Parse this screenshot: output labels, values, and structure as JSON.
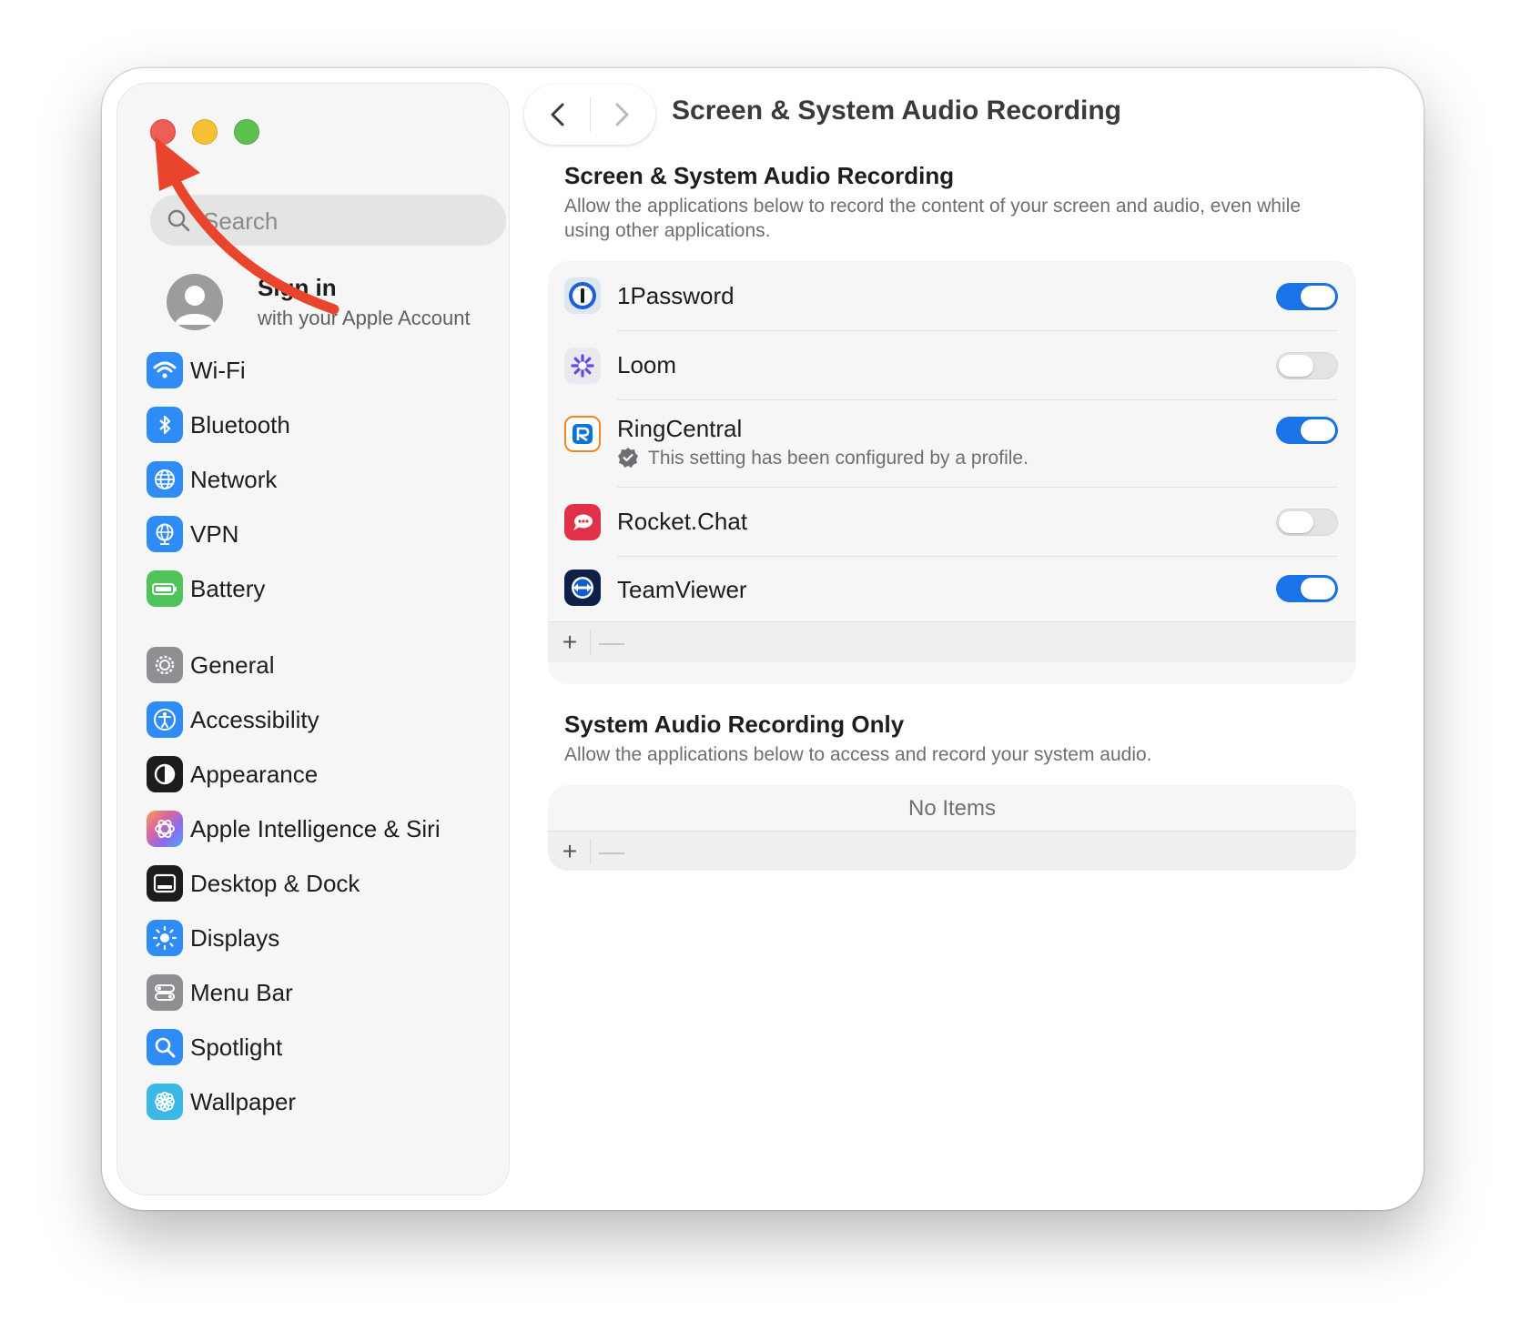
{
  "sidebar": {
    "search_placeholder": "Search",
    "account": {
      "title": "Sign in",
      "subtitle": "with your Apple Account"
    },
    "items": [
      {
        "label": "Wi-Fi",
        "icon": "wifi-icon",
        "color": "#2f8cf6"
      },
      {
        "label": "Bluetooth",
        "icon": "bluetooth-icon",
        "color": "#2f8cf6"
      },
      {
        "label": "Network",
        "icon": "globe-icon",
        "color": "#2f8cf6"
      },
      {
        "label": "VPN",
        "icon": "vpn-globe-icon",
        "color": "#2f8cf6"
      },
      {
        "label": "Battery",
        "icon": "battery-icon",
        "color": "#4ec45a"
      },
      {
        "label": "General",
        "icon": "gear-icon",
        "color": "#8e8e93"
      },
      {
        "label": "Accessibility",
        "icon": "accessibility-icon",
        "color": "#2f8cf6"
      },
      {
        "label": "Appearance",
        "icon": "appearance-icon",
        "color": "#1c1c1e"
      },
      {
        "label": "Apple Intelligence & Siri",
        "icon": "siri-icon",
        "color": "#e0669a"
      },
      {
        "label": "Desktop & Dock",
        "icon": "dock-icon",
        "color": "#1c1c1e"
      },
      {
        "label": "Displays",
        "icon": "sun-icon",
        "color": "#2f8cf6"
      },
      {
        "label": "Menu Bar",
        "icon": "menu-bar-icon",
        "color": "#8e8e93"
      },
      {
        "label": "Spotlight",
        "icon": "spotlight-icon",
        "color": "#2f8cf6"
      },
      {
        "label": "Wallpaper",
        "icon": "wallpaper-icon",
        "color": "#3cb8e8"
      }
    ]
  },
  "header": {
    "title": "Screen & System Audio Recording"
  },
  "screen_section": {
    "heading": "Screen & System Audio Recording",
    "description": "Allow the applications below to record the content of your screen and audio, even while using other applications.",
    "apps": [
      {
        "name": "1Password",
        "enabled": true,
        "icon": "1password-icon"
      },
      {
        "name": "Loom",
        "enabled": false,
        "icon": "loom-icon"
      },
      {
        "name": "RingCentral",
        "enabled": true,
        "icon": "ringcentral-icon",
        "note": "This setting has been configured by a profile."
      },
      {
        "name": "Rocket.Chat",
        "enabled": false,
        "icon": "rocketchat-icon"
      },
      {
        "name": "TeamViewer",
        "enabled": true,
        "icon": "teamviewer-icon"
      }
    ],
    "add_label": "+",
    "remove_label": "—"
  },
  "audio_section": {
    "heading": "System Audio Recording Only",
    "description": "Allow the applications below to access and record your system audio.",
    "empty_text": "No Items",
    "add_label": "+",
    "remove_label": "—"
  },
  "colors": {
    "accent": "#1a73e8",
    "annotation_arrow": "#e8452c"
  }
}
